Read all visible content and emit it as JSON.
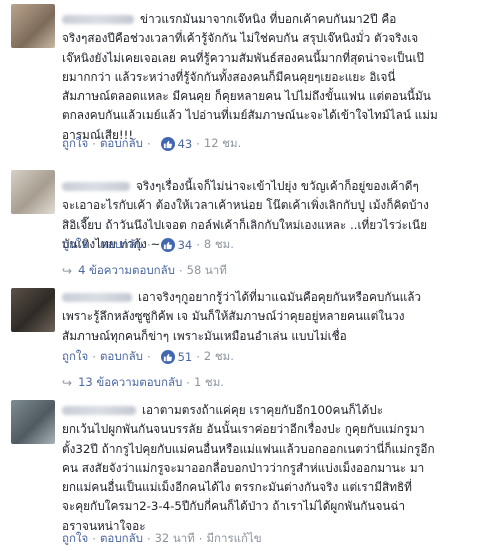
{
  "comments": [
    {
      "text": "ข่าวแรกมันมาจากเจ๊หนิง ที่บอกเค้าคบกันมา2ปี คือ\nจริงๆสองปีคือช่วงเวลาที่เค้ารู้จักกัน ไม่ใช่คบกัน สรุปเจ๊หนิงมั่ว ตัวจริงเจ\nเจ๊หนิงยังไม่เคยเจอเลย คนที่รู้ความสัมพันธ์สองคนนี้มากที่สุดน่าจะเป็นเป๊\nยมากกว่า แล้วระหว่างที่รู้จักกันทั้งสองคนก็มีคนคุยๆเยอะแยะ อิเจนี่\nสัมภาษณ์ตลอดแหละ มีคนคุย ก็คุยหลายคน ไปไม่ถึงขั้นแฟน แต่ตอนนี้มัน\nตกลงคบกันแล้วเมย์แล้ว ไปอ่านที่เมย์สัมภาษณ์นะจะได้เข้าใจไทม์ไลน์ แม่ม\nอารมณ์เสีย!!!",
      "like": "ถูกใจ",
      "reply": "ตอบกลับ",
      "reactions": "43",
      "time": "12 ชม."
    },
    {
      "text": "จริงๆเรื่องนี้เจก็ไม่น่าจะเข้าไปยุ่ง ขวัญเค้าก็อยู่ของเค้าดีๆ\nจะเอาอะไรกับเค้า ต้องให้เวลาเค้าหน่อย โน๊ตเค้าเพิ่งเลิกกับปู เม้งก็คิดบ้าง\nสิอิเจี๊ยบ ถ้าวันนึงไปเจอต กอล์ฟเค้าก็เลิกกับใหม่เองแหละ ..เที่ยวไรว่ะเนีย\nบันเทิงไทย ท่ากุ้ง ~~",
      "like": "ถูกใจ",
      "reply": "ตอบกลับ",
      "reactions": "34",
      "time": "8 ชม.",
      "replies": "4 ข้อความตอบกลับ",
      "replies_time": "58 นาที"
    },
    {
      "text": "เอาจริงๆกูอยากรู้ว่าได้ที่มาแฉมันคือคุยกันหรือคบกันแล้ว\nเพราะรู้ลึกหลังซูซูกิค้พ เจ มันก็ให้สัมภาษณ์ว่าคุยอยู่หลายคนแต่ในวง\nสัมภาษณ์ทุกคนก็ข่าๆ เพราะมันเหมือนอำเล่น แบบไม่เชื่อ",
      "like": "ถูกใจ",
      "reply": "ตอบกลับ",
      "reactions": "51",
      "time": "2 ชม.",
      "replies": "13 ข้อความตอบกลับ",
      "replies_time": "1 ชม."
    },
    {
      "text": "เอาตามตรงถ้าแค่คุย เราคุยกับอีก100คนก็ได้ปะ\nยกเว้นไปผูกพันกันจนบรรลัย อันนั้นเราค่อยว่าอีกเรื่องปะ กูคุยกับแม่กรูมา\nตั้ง32ปี ถ้ากรูไปคุยกับแม่คนอื่นหรือแม่แฟนแล้วบอกออกเนตว่านี่ก็แม่กรูอีก\nคน สงสัยจังว่าแม่กรูจะมาออกลื่อบอกป่าวว่ากรูสำห่แบ่งเม็งออกมานะ มา\nยกแม่คนอื่นเป็นแม่เม็งอีกคนได้ไง ตรรกะมันต่างกันจริง แต่เรามีสิทธิที่\nจะคุยกับใครมา2-3-4-5ปีกับกี่คนก็ได้ป่าว ถ้าเราไม่ได้ผูกพันกันจนฉ่า\nอราจนหน่าใจอะ",
      "like": "ถูกใจ",
      "reply": "ตอบกลับ",
      "time": "32 นาที",
      "edited": "มีการแก้ไข"
    }
  ],
  "colors": {
    "link": "#4b67a1",
    "meta": "#8d949e",
    "like_badge": "#4267b2"
  }
}
